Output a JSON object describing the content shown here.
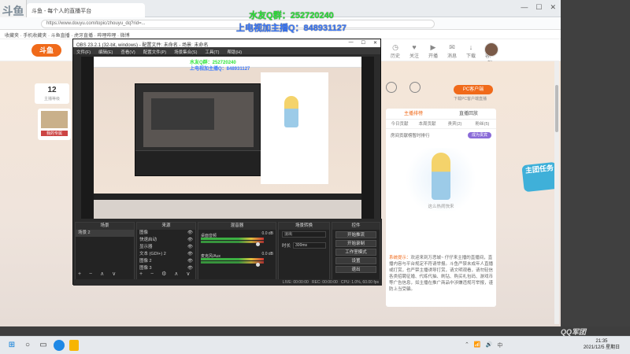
{
  "watermark": {
    "line1": "水友Q群：252720240",
    "line2": "上电视加主播Q：848931127"
  },
  "browser": {
    "logo": "斗鱼",
    "active_tab": "斗鱼 - 每个人的直播平台",
    "url": "https://www.douyu.com/topic/zhouyu_dq?rid=...",
    "bookmarks": "收藏夹 · 手机收藏夹 · 斗鱼直播 · 虎牙直播 · 哔哩哔哩 · 微博",
    "window_controls": [
      "—",
      "☐",
      "✕"
    ],
    "header_icons": [
      {
        "icon": "history-icon",
        "glyph": "◷",
        "label": "历史"
      },
      {
        "icon": "follow-icon",
        "glyph": "♥",
        "label": "关注"
      },
      {
        "icon": "live-icon",
        "glyph": "▶",
        "label": "开播"
      },
      {
        "icon": "message-icon",
        "glyph": "✉",
        "label": "消息"
      },
      {
        "icon": "download-icon",
        "glyph": "↓",
        "label": "下载"
      },
      {
        "icon": "app-icon",
        "glyph": "☐",
        "label": "客户端"
      }
    ],
    "left_stats": {
      "num": "12",
      "label": "主播等级"
    },
    "left_card_caption": "我的专属",
    "right_panel": {
      "pc_button": "PC客户端",
      "pc_sub": "下载PC客户端直播",
      "tabs": [
        "主播排榜",
        "直播回放"
      ],
      "subtabs": [
        "今日贡献",
        "本周贡献",
        "贵宾(2)",
        "粉丝(5)"
      ],
      "announce": "房间贡献榜暂时排行",
      "announce_btn": "成为贵宾",
      "art_caption": "这么热闹快来",
      "notice_key": "系统提示：",
      "notice_text": "欢迎来到万恶城~ 仔仔来主播的直播间，直播内容与平台规定不符请举报。斗鱼严禁未成年人直播或打赏，也严禁主播诱导打赏，请文明观看，请勿轻信各类招聘征婚、代练代抽、刷钻、购买礼包码、游戏币等广告信息，如主播在推广商品中涉嫌违规可举报，谨防上当受骗。"
    },
    "right_badge": "主团任务"
  },
  "obs": {
    "title": "OBS 23.2.1 (32-bit, windows) - 配置文件: 未命名 - 场景: 未命名",
    "menu": [
      "文件(F)",
      "编辑(E)",
      "查看(V)",
      "配置文件(P)",
      "场景集合(S)",
      "工具(T)",
      "帮助(H)"
    ],
    "preview_wm1": "水友Q群：252720240",
    "preview_wm2": "上电视加主播Q：848931127",
    "docks": {
      "scenes": {
        "title": "场景",
        "items": [
          "场景 2"
        ]
      },
      "sources": {
        "title": "来源",
        "items": [
          "图像",
          "快速启动",
          "显示器",
          "文本 (GDI+) 2",
          "图像 2",
          "图像 3"
        ]
      },
      "mixer": {
        "title": "混音器",
        "channels": [
          {
            "name": "桌面音频",
            "db": "0.0 dB"
          },
          {
            "name": "麦克风/Aux",
            "db": "0.0 dB"
          }
        ]
      },
      "transitions": {
        "title": "场景转换",
        "type": "淡出",
        "duration_label": "时长",
        "duration": "300ms"
      },
      "controls": {
        "title": "控件",
        "buttons": [
          "开始推流",
          "开始录制",
          "工作室模式",
          "设置",
          "退出"
        ]
      }
    },
    "status": "LIVE: 00:00:00   REC: 00:00:00   CPU: 1.0%, 60.00 fps"
  },
  "desktop": {
    "brand": "QQ",
    "brand_suffix": "军团"
  },
  "taskbar": {
    "time": "21:35",
    "date": "2021/12/5 星期日",
    "tray": [
      "⌃",
      "📶",
      "🔊",
      "中"
    ]
  }
}
